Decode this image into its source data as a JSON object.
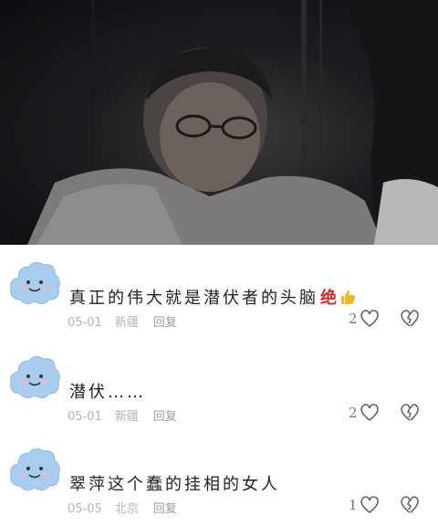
{
  "video": {
    "icon": "video-frame-thumbnail"
  },
  "comments": [
    {
      "text": "真正的伟大就是潜伏者的头脑",
      "emoji_text": "绝",
      "emoji_icon": "thumbs-up-icon",
      "date": "05-01",
      "location": "新疆",
      "reply_label": "回复",
      "like_count": "2"
    },
    {
      "text": "潜伏……",
      "date": "05-01",
      "location": "新疆",
      "reply_label": "回复",
      "like_count": "2"
    },
    {
      "text": "翠萍这个蠢的挂相的女人",
      "date": "05-05",
      "location": "北京",
      "reply_label": "回复",
      "like_count": "1"
    }
  ],
  "colors": {
    "avatar_cloud": "#a9cdee",
    "text": "#222222",
    "meta": "#b5b5b5",
    "thumb": "#f5b820",
    "jue": "#e0241f"
  }
}
